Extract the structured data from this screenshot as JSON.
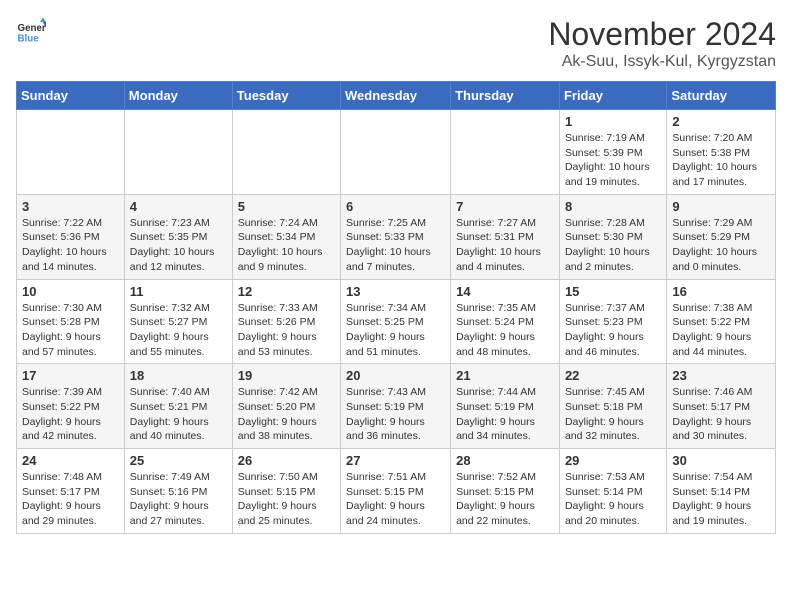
{
  "logo": {
    "line1": "General",
    "line2": "Blue"
  },
  "title": "November 2024",
  "location": "Ak-Suu, Issyk-Kul, Kyrgyzstan",
  "days_of_week": [
    "Sunday",
    "Monday",
    "Tuesday",
    "Wednesday",
    "Thursday",
    "Friday",
    "Saturday"
  ],
  "weeks": [
    [
      {
        "day": "",
        "info": ""
      },
      {
        "day": "",
        "info": ""
      },
      {
        "day": "",
        "info": ""
      },
      {
        "day": "",
        "info": ""
      },
      {
        "day": "",
        "info": ""
      },
      {
        "day": "1",
        "info": "Sunrise: 7:19 AM\nSunset: 5:39 PM\nDaylight: 10 hours and 19 minutes."
      },
      {
        "day": "2",
        "info": "Sunrise: 7:20 AM\nSunset: 5:38 PM\nDaylight: 10 hours and 17 minutes."
      }
    ],
    [
      {
        "day": "3",
        "info": "Sunrise: 7:22 AM\nSunset: 5:36 PM\nDaylight: 10 hours and 14 minutes."
      },
      {
        "day": "4",
        "info": "Sunrise: 7:23 AM\nSunset: 5:35 PM\nDaylight: 10 hours and 12 minutes."
      },
      {
        "day": "5",
        "info": "Sunrise: 7:24 AM\nSunset: 5:34 PM\nDaylight: 10 hours and 9 minutes."
      },
      {
        "day": "6",
        "info": "Sunrise: 7:25 AM\nSunset: 5:33 PM\nDaylight: 10 hours and 7 minutes."
      },
      {
        "day": "7",
        "info": "Sunrise: 7:27 AM\nSunset: 5:31 PM\nDaylight: 10 hours and 4 minutes."
      },
      {
        "day": "8",
        "info": "Sunrise: 7:28 AM\nSunset: 5:30 PM\nDaylight: 10 hours and 2 minutes."
      },
      {
        "day": "9",
        "info": "Sunrise: 7:29 AM\nSunset: 5:29 PM\nDaylight: 10 hours and 0 minutes."
      }
    ],
    [
      {
        "day": "10",
        "info": "Sunrise: 7:30 AM\nSunset: 5:28 PM\nDaylight: 9 hours and 57 minutes."
      },
      {
        "day": "11",
        "info": "Sunrise: 7:32 AM\nSunset: 5:27 PM\nDaylight: 9 hours and 55 minutes."
      },
      {
        "day": "12",
        "info": "Sunrise: 7:33 AM\nSunset: 5:26 PM\nDaylight: 9 hours and 53 minutes."
      },
      {
        "day": "13",
        "info": "Sunrise: 7:34 AM\nSunset: 5:25 PM\nDaylight: 9 hours and 51 minutes."
      },
      {
        "day": "14",
        "info": "Sunrise: 7:35 AM\nSunset: 5:24 PM\nDaylight: 9 hours and 48 minutes."
      },
      {
        "day": "15",
        "info": "Sunrise: 7:37 AM\nSunset: 5:23 PM\nDaylight: 9 hours and 46 minutes."
      },
      {
        "day": "16",
        "info": "Sunrise: 7:38 AM\nSunset: 5:22 PM\nDaylight: 9 hours and 44 minutes."
      }
    ],
    [
      {
        "day": "17",
        "info": "Sunrise: 7:39 AM\nSunset: 5:22 PM\nDaylight: 9 hours and 42 minutes."
      },
      {
        "day": "18",
        "info": "Sunrise: 7:40 AM\nSunset: 5:21 PM\nDaylight: 9 hours and 40 minutes."
      },
      {
        "day": "19",
        "info": "Sunrise: 7:42 AM\nSunset: 5:20 PM\nDaylight: 9 hours and 38 minutes."
      },
      {
        "day": "20",
        "info": "Sunrise: 7:43 AM\nSunset: 5:19 PM\nDaylight: 9 hours and 36 minutes."
      },
      {
        "day": "21",
        "info": "Sunrise: 7:44 AM\nSunset: 5:19 PM\nDaylight: 9 hours and 34 minutes."
      },
      {
        "day": "22",
        "info": "Sunrise: 7:45 AM\nSunset: 5:18 PM\nDaylight: 9 hours and 32 minutes."
      },
      {
        "day": "23",
        "info": "Sunrise: 7:46 AM\nSunset: 5:17 PM\nDaylight: 9 hours and 30 minutes."
      }
    ],
    [
      {
        "day": "24",
        "info": "Sunrise: 7:48 AM\nSunset: 5:17 PM\nDaylight: 9 hours and 29 minutes."
      },
      {
        "day": "25",
        "info": "Sunrise: 7:49 AM\nSunset: 5:16 PM\nDaylight: 9 hours and 27 minutes."
      },
      {
        "day": "26",
        "info": "Sunrise: 7:50 AM\nSunset: 5:15 PM\nDaylight: 9 hours and 25 minutes."
      },
      {
        "day": "27",
        "info": "Sunrise: 7:51 AM\nSunset: 5:15 PM\nDaylight: 9 hours and 24 minutes."
      },
      {
        "day": "28",
        "info": "Sunrise: 7:52 AM\nSunset: 5:15 PM\nDaylight: 9 hours and 22 minutes."
      },
      {
        "day": "29",
        "info": "Sunrise: 7:53 AM\nSunset: 5:14 PM\nDaylight: 9 hours and 20 minutes."
      },
      {
        "day": "30",
        "info": "Sunrise: 7:54 AM\nSunset: 5:14 PM\nDaylight: 9 hours and 19 minutes."
      }
    ]
  ]
}
